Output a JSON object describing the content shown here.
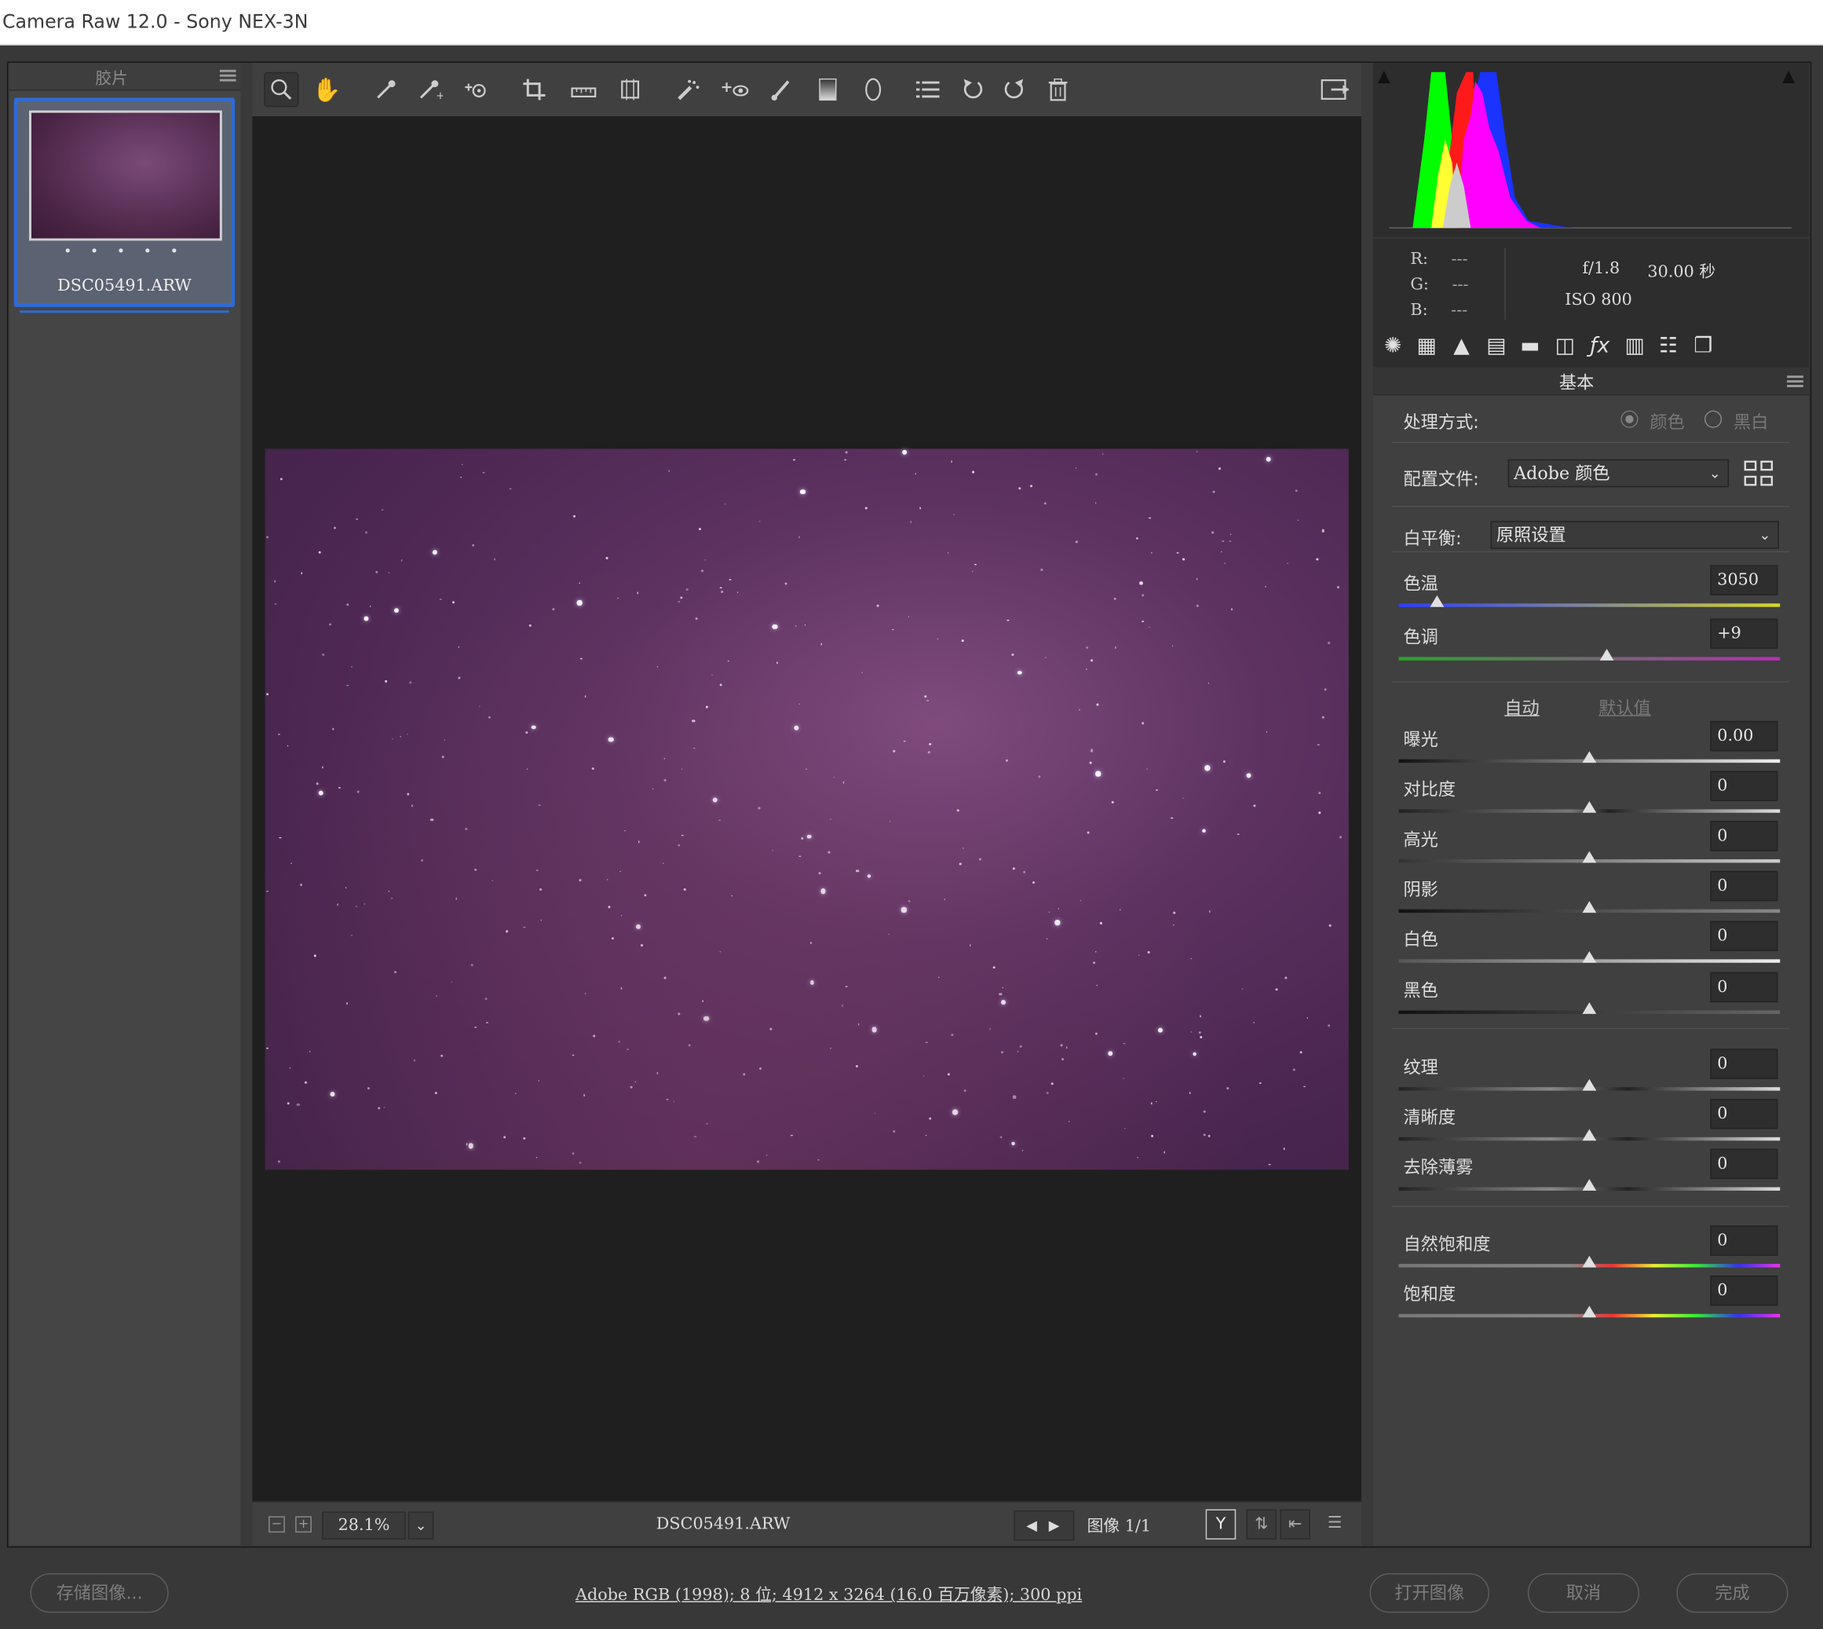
{
  "window": {
    "title": "Camera Raw 12.0 -  Sony NEX-3N"
  },
  "filmstrip": {
    "header": "胶片",
    "thumbnail": {
      "dots": "• • • • •",
      "filename": "DSC05491.ARW"
    }
  },
  "statusbar": {
    "zoom": "28.1%",
    "filename": "DSC05491.ARW",
    "image_counter": "图像 1/1"
  },
  "readout": {
    "r_label": "R:",
    "g_label": "G:",
    "b_label": "B:",
    "r": "---",
    "g": "---",
    "b": "---",
    "aperture": "f/1.8",
    "shutter": "30.00 秒",
    "iso": "ISO 800"
  },
  "panel": {
    "section_title": "基本",
    "treatment_label": "处理方式:",
    "treatment_color": "颜色",
    "treatment_bw": "黑白",
    "profile_label": "配置文件:",
    "profile_value": "Adobe 颜色",
    "wb_label": "白平衡:",
    "wb_value": "原照设置",
    "auto": "自动",
    "default": "默认值",
    "sliders": [
      {
        "label": "色温",
        "value": "3050",
        "pos": 0.1
      },
      {
        "label": "色调",
        "value": "+9",
        "pos": 0.545
      },
      {
        "label": "曝光",
        "value": "0.00",
        "pos": 0.5
      },
      {
        "label": "对比度",
        "value": "0",
        "pos": 0.5
      },
      {
        "label": "高光",
        "value": "0",
        "pos": 0.5
      },
      {
        "label": "阴影",
        "value": "0",
        "pos": 0.5
      },
      {
        "label": "白色",
        "value": "0",
        "pos": 0.5
      },
      {
        "label": "黑色",
        "value": "0",
        "pos": 0.5
      },
      {
        "label": "纹理",
        "value": "0",
        "pos": 0.5
      },
      {
        "label": "清晰度",
        "value": "0",
        "pos": 0.5
      },
      {
        "label": "去除薄雾",
        "value": "0",
        "pos": 0.5
      },
      {
        "label": "自然饱和度",
        "value": "0",
        "pos": 0.5
      },
      {
        "label": "饱和度",
        "value": "0",
        "pos": 0.5
      }
    ]
  },
  "bottom": {
    "save_button": "存储图像...",
    "workflow_info": "Adobe RGB (1998); 8 位;  4912 x 3264 (16.0 百万像素); 300 ppi",
    "open_button": "打开图像",
    "cancel_button": "取消",
    "done_button": "完成"
  },
  "colors": {
    "accent": "#2f6bd8",
    "photo": "#5d3260"
  }
}
